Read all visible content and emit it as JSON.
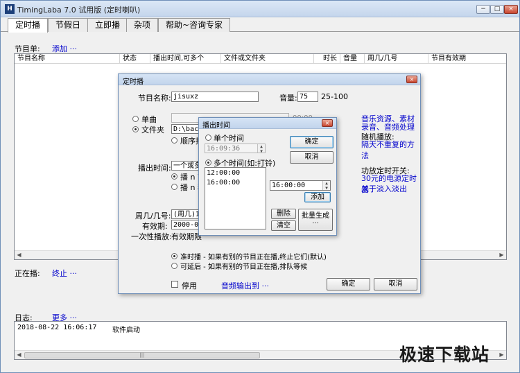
{
  "window": {
    "title": "TimingLaba 7.0 试用版 (定时喇叭)",
    "app_icon": "H",
    "controls": [
      "−",
      "□",
      "×"
    ]
  },
  "tabs": [
    "定时播",
    "节假日",
    "立即播",
    "杂项",
    "帮助~咨询专家"
  ],
  "program_list": {
    "label": "节目单:",
    "add_link": "添加 ···",
    "columns": [
      "节目名称",
      "状态",
      "播出时间,可多个",
      "文件或文件夹",
      "时长",
      "音量",
      "周几/几号",
      "节目有效期"
    ]
  },
  "now_playing": {
    "label": "正在播:",
    "stop_link": "终止 ···"
  },
  "log": {
    "label": "日志:",
    "more_link": "更多 ···",
    "entries": [
      {
        "time": "2018-08-22 16:06:17",
        "text": "软件启动"
      }
    ]
  },
  "dialog_program": {
    "title": "定时播",
    "name_label": "节目名称:",
    "name_value": "jisuxz",
    "volume_label": "音量:",
    "volume_value": "75",
    "volume_range": "25-100",
    "radio_single": "单曲",
    "radio_folder": "文件夹",
    "folder_value": "D:\\backu",
    "seq_play": "顺序播",
    "single_value": "",
    "time_hint": "00:00",
    "right_links": [
      "音乐资源、素材",
      "录音、音频处理"
    ],
    "random_label": "随机播放:",
    "random_link": "隔天不重复的方法",
    "broadcast_time_label": "播出时间:",
    "broadcast_time_value": "一个或多",
    "play_n1": "播 n 首",
    "play_n2": "播 n 秒",
    "power_label": "功放定时开关:",
    "power_link": "30元的电源定时器",
    "fade_link": "关于淡入淡出",
    "weekday_label": "周几/几号:",
    "weekday_value": "(周几)12",
    "valid_label": "有效期:",
    "valid_value": "2000-01-",
    "once_label": "一次性播放:",
    "once_value": "有效期限",
    "option_ontime": "准时播 - 如果有别的节目正在播,终止它们(默认)",
    "option_delay": "可延后 - 如果有别的节目正在播,排队等候",
    "disable_label": "停用",
    "audio_out_link": "音频输出到 ···",
    "ok": "确定",
    "cancel": "取消"
  },
  "dialog_time": {
    "title": "播出时间",
    "single_label": "单个时间",
    "single_value": "16:09:36",
    "multi_label": "多个时间(如:打铃)",
    "times": [
      "12:00:00",
      "16:00:00"
    ],
    "new_time": "16:00:00",
    "add": "添加",
    "delete": "删除",
    "clear": "清空",
    "batch": "批量生成",
    "batch_dots": "···",
    "ok": "确定",
    "cancel": "取消"
  },
  "watermark": "极速下载站"
}
